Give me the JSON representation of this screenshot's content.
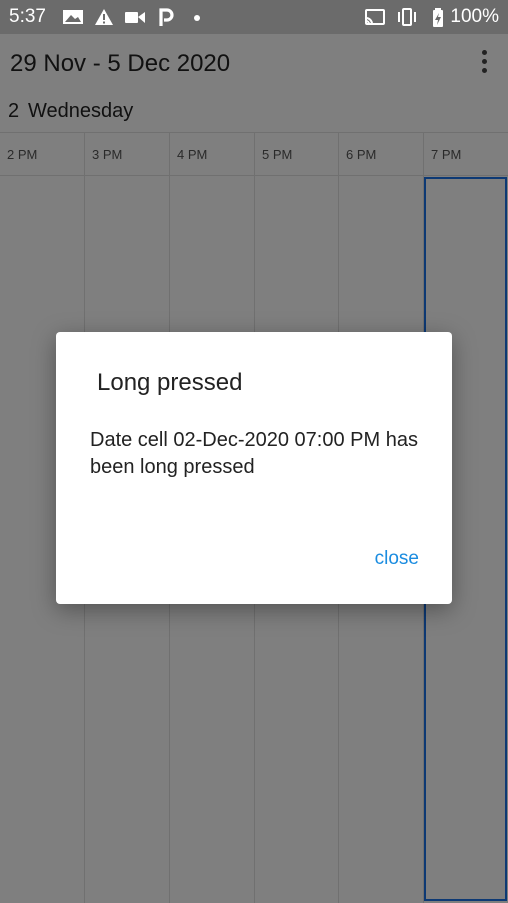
{
  "status_bar": {
    "time": "5:37",
    "battery": "100%",
    "left_icons": [
      "image-icon",
      "alert-icon",
      "video-icon",
      "parking-icon",
      "dot-icon"
    ],
    "right_icons": [
      "cast-icon",
      "vibrate-icon",
      "battery-icon"
    ]
  },
  "app_bar": {
    "title": "29 Nov - 5 Dec 2020",
    "menu_icon": "more-vert-icon"
  },
  "day_header": {
    "day_number": "2",
    "day_name": "Wednesday"
  },
  "time_slots": [
    "2 PM",
    "3 PM",
    "4 PM",
    "5 PM",
    "6 PM",
    "7 PM"
  ],
  "colors": {
    "accent": "#1a73e8",
    "dialog_button": "#1a8ce0",
    "scrim": "#000000"
  },
  "dialog": {
    "title": "Long pressed",
    "message": "Date cell 02-Dec-2020 07:00 PM has been long pressed",
    "button": "close"
  }
}
